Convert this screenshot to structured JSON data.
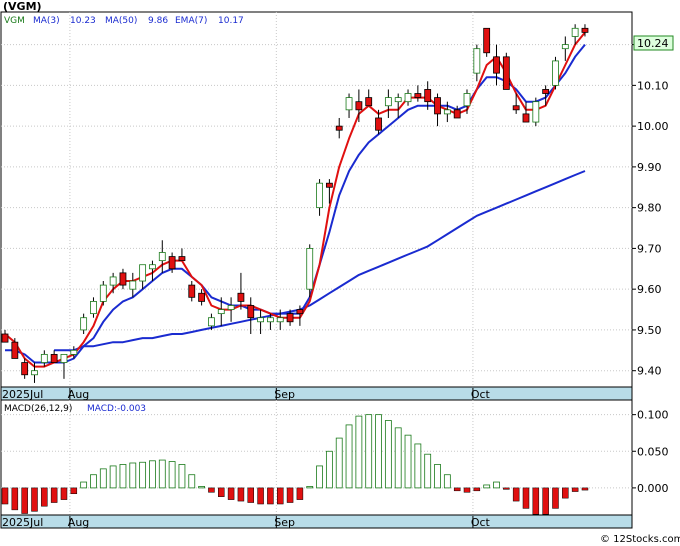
{
  "colors": {
    "up": "#1a7a1a",
    "down": "#e01010",
    "ma_short": "#e01010",
    "ma_long": "#1a2bd0",
    "axis_bar": "#b8dce8",
    "grid": "#c8c8c8",
    "price_tag_bg": "#ddffdd",
    "price_tag_border": "#228822"
  },
  "header": {
    "ticker": "(VGM)",
    "ma3_label": "MA(3)",
    "ma3_value": "10.23",
    "ma50_label": "MA(50)",
    "ma50_value": "9.86",
    "ema7_label": "EMA(7)",
    "ema7_value": "10.17"
  },
  "macd_header": {
    "label": "MACD(26,12,9)",
    "value_label": "MACD:-0.003"
  },
  "price_tag": "10.24",
  "footer": "© 12Stocks.com",
  "chart_data": [
    {
      "type": "candlestick",
      "title": "(VGM)",
      "y_ticks": [
        "9.40",
        "9.50",
        "9.60",
        "9.70",
        "9.80",
        "9.90",
        "10.00",
        "10.10",
        "10.20"
      ],
      "ylim": [
        9.36,
        10.28
      ],
      "x_labels": [
        {
          "label": "2025Jul",
          "index": 0
        },
        {
          "label": "Aug",
          "index": 7
        },
        {
          "label": "Sep",
          "index": 28
        },
        {
          "label": "Oct",
          "index": 48
        }
      ],
      "candles": [
        [
          9.49,
          9.5,
          9.47,
          9.47
        ],
        [
          9.47,
          9.48,
          9.43,
          9.43
        ],
        [
          9.42,
          9.43,
          9.38,
          9.39
        ],
        [
          9.39,
          9.42,
          9.37,
          9.4
        ],
        [
          9.42,
          9.45,
          9.41,
          9.44
        ],
        [
          9.44,
          9.45,
          9.42,
          9.42
        ],
        [
          9.42,
          9.44,
          9.38,
          9.44
        ],
        [
          9.44,
          9.46,
          9.43,
          9.45
        ],
        [
          9.5,
          9.54,
          9.49,
          9.53
        ],
        [
          9.54,
          9.58,
          9.53,
          9.57
        ],
        [
          9.57,
          9.62,
          9.56,
          9.61
        ],
        [
          9.61,
          9.64,
          9.59,
          9.63
        ],
        [
          9.64,
          9.65,
          9.6,
          9.61
        ],
        [
          9.6,
          9.64,
          9.58,
          9.62
        ],
        [
          9.62,
          9.66,
          9.6,
          9.66
        ],
        [
          9.65,
          9.67,
          9.62,
          9.66
        ],
        [
          9.67,
          9.72,
          9.64,
          9.69
        ],
        [
          9.68,
          9.69,
          9.64,
          9.65
        ],
        [
          9.68,
          9.7,
          9.67,
          9.67
        ],
        [
          9.61,
          9.62,
          9.57,
          9.58
        ],
        [
          9.59,
          9.6,
          9.56,
          9.57
        ],
        [
          9.51,
          9.54,
          9.5,
          9.53
        ],
        [
          9.54,
          9.58,
          9.51,
          9.55
        ],
        [
          9.55,
          9.58,
          9.52,
          9.56
        ],
        [
          9.59,
          9.64,
          9.55,
          9.57
        ],
        [
          9.56,
          9.58,
          9.49,
          9.53
        ],
        [
          9.52,
          9.55,
          9.49,
          9.53
        ],
        [
          9.52,
          9.54,
          9.5,
          9.53
        ],
        [
          9.52,
          9.55,
          9.5,
          9.53
        ],
        [
          9.54,
          9.55,
          9.51,
          9.52
        ],
        [
          9.55,
          9.56,
          9.51,
          9.54
        ],
        [
          9.6,
          9.71,
          9.58,
          9.7
        ],
        [
          9.8,
          9.87,
          9.78,
          9.86
        ],
        [
          9.86,
          9.87,
          9.81,
          9.85
        ],
        [
          10.0,
          10.02,
          9.97,
          9.99
        ],
        [
          10.04,
          10.08,
          10.02,
          10.07
        ],
        [
          10.06,
          10.09,
          10.01,
          10.04
        ],
        [
          10.07,
          10.09,
          10.05,
          10.05
        ],
        [
          10.02,
          10.04,
          9.98,
          9.99
        ],
        [
          10.05,
          10.09,
          10.02,
          10.07
        ],
        [
          10.06,
          10.08,
          10.02,
          10.07
        ],
        [
          10.06,
          10.09,
          10.05,
          10.08
        ],
        [
          10.08,
          10.1,
          10.06,
          10.07
        ],
        [
          10.09,
          10.11,
          10.04,
          10.06
        ],
        [
          10.07,
          10.08,
          10.0,
          10.03
        ],
        [
          10.03,
          10.06,
          10.01,
          10.04
        ],
        [
          10.04,
          10.05,
          10.02,
          10.02
        ],
        [
          10.05,
          10.09,
          10.03,
          10.08
        ],
        [
          10.13,
          10.2,
          10.11,
          10.19
        ],
        [
          10.24,
          10.24,
          10.17,
          10.18
        ],
        [
          10.17,
          10.2,
          10.1,
          10.13
        ],
        [
          10.17,
          10.18,
          10.09,
          10.09
        ],
        [
          10.05,
          10.08,
          10.03,
          10.04
        ],
        [
          10.03,
          10.06,
          10.01,
          10.01
        ],
        [
          10.01,
          10.07,
          10.0,
          10.06
        ],
        [
          10.09,
          10.1,
          10.05,
          10.08
        ],
        [
          10.1,
          10.17,
          10.09,
          10.16
        ],
        [
          10.19,
          10.22,
          10.16,
          10.2
        ],
        [
          10.22,
          10.25,
          10.2,
          10.24
        ],
        [
          10.24,
          10.25,
          10.22,
          10.23
        ]
      ],
      "series": [
        {
          "name": "MA(3)",
          "values": [
            9.49,
            9.47,
            9.43,
            9.41,
            9.41,
            9.42,
            9.43,
            9.44,
            9.47,
            9.51,
            9.57,
            9.6,
            9.62,
            9.62,
            9.63,
            9.64,
            9.66,
            9.67,
            9.67,
            9.63,
            9.61,
            9.56,
            9.55,
            9.55,
            9.56,
            9.56,
            9.55,
            9.54,
            9.53,
            9.53,
            9.53,
            9.57,
            9.66,
            9.8,
            9.9,
            9.97,
            10.03,
            10.05,
            10.03,
            10.04,
            10.04,
            10.07,
            10.07,
            10.07,
            10.05,
            10.04,
            10.03,
            10.04,
            10.09,
            10.15,
            10.17,
            10.13,
            10.08,
            10.04,
            10.04,
            10.05,
            10.1,
            10.15,
            10.2,
            10.23
          ]
        },
        {
          "name": "EMA(7)",
          "values": [
            9.45,
            9.45,
            9.44,
            9.42,
            9.42,
            9.42,
            9.42,
            9.43,
            9.46,
            9.48,
            9.52,
            9.55,
            9.57,
            9.58,
            9.6,
            9.62,
            9.64,
            9.65,
            9.65,
            9.63,
            9.61,
            9.58,
            9.57,
            9.56,
            9.56,
            9.55,
            9.55,
            9.54,
            9.54,
            9.54,
            9.54,
            9.58,
            9.66,
            9.74,
            9.83,
            9.89,
            9.93,
            9.96,
            9.98,
            10.0,
            10.02,
            10.04,
            10.05,
            10.05,
            10.05,
            10.05,
            10.04,
            10.05,
            10.09,
            10.12,
            10.12,
            10.11,
            10.09,
            10.06,
            10.06,
            10.07,
            10.1,
            10.13,
            10.17,
            10.2
          ]
        },
        {
          "name": "MA(50)",
          "values": [
            null,
            null,
            null,
            null,
            null,
            9.45,
            9.45,
            9.45,
            9.46,
            9.46,
            9.465,
            9.47,
            9.47,
            9.475,
            9.48,
            9.48,
            9.485,
            9.49,
            9.49,
            9.495,
            9.5,
            9.505,
            9.51,
            9.515,
            9.52,
            9.525,
            9.53,
            9.535,
            9.54,
            9.545,
            9.55,
            9.56,
            9.575,
            9.59,
            9.605,
            9.62,
            9.635,
            9.645,
            9.655,
            9.665,
            9.675,
            9.685,
            9.695,
            9.705,
            9.72,
            9.735,
            9.75,
            9.765,
            9.78,
            9.79,
            9.8,
            9.81,
            9.82,
            9.83,
            9.84,
            9.85,
            9.86,
            9.87,
            9.88,
            9.89
          ]
        }
      ]
    },
    {
      "type": "bar",
      "title": "MACD(26,12,9)",
      "y_ticks": [
        "0.100",
        "0.050",
        "0.000"
      ],
      "ylim": [
        -0.037,
        0.12
      ],
      "values": [
        -0.022,
        -0.03,
        -0.035,
        -0.032,
        -0.025,
        -0.02,
        -0.016,
        -0.008,
        0.008,
        0.018,
        0.026,
        0.03,
        0.032,
        0.034,
        0.035,
        0.037,
        0.038,
        0.036,
        0.032,
        0.018,
        0.002,
        -0.006,
        -0.012,
        -0.016,
        -0.018,
        -0.02,
        -0.022,
        -0.022,
        -0.022,
        -0.02,
        -0.016,
        0.002,
        0.03,
        0.05,
        0.068,
        0.086,
        0.098,
        0.1,
        0.1,
        0.092,
        0.082,
        0.072,
        0.06,
        0.046,
        0.032,
        0.018,
        -0.004,
        -0.006,
        -0.004,
        0.004,
        0.008,
        -0.002,
        -0.018,
        -0.028,
        -0.036,
        -0.036,
        -0.028,
        -0.014,
        -0.005,
        -0.003
      ]
    }
  ]
}
